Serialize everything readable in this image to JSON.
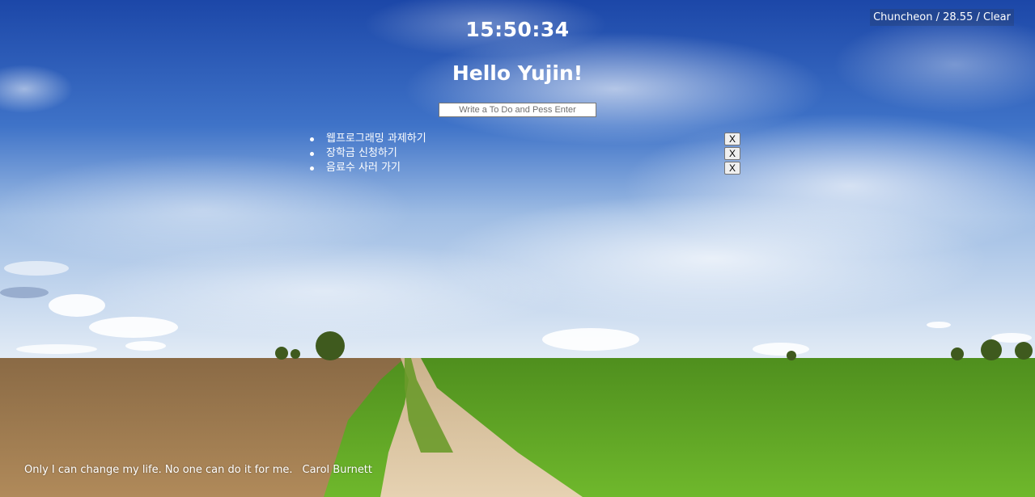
{
  "weather": {
    "text": "Chuncheon / 28.55 / Clear"
  },
  "clock": {
    "time": "15:50:34"
  },
  "greeting": {
    "text": "Hello Yujin!"
  },
  "todo_form": {
    "placeholder": "Write a To Do and Pess Enter",
    "value": ""
  },
  "todos": [
    {
      "text": "웹프로그래밍 과제하기",
      "delete_label": "X"
    },
    {
      "text": "장학금 신청하기",
      "delete_label": "X"
    },
    {
      "text": "음료수 사러 가기",
      "delete_label": "X"
    }
  ],
  "quote": {
    "text": "Only I can change my life. No one can do it for me.",
    "author": "Carol Burnett"
  },
  "background": {
    "description_icon": "landscape-photo"
  },
  "colors": {
    "text": "#ffffff",
    "sky_top": "#1f4fb0",
    "field_green": "#5fa024",
    "field_brown": "#a07a4c"
  }
}
